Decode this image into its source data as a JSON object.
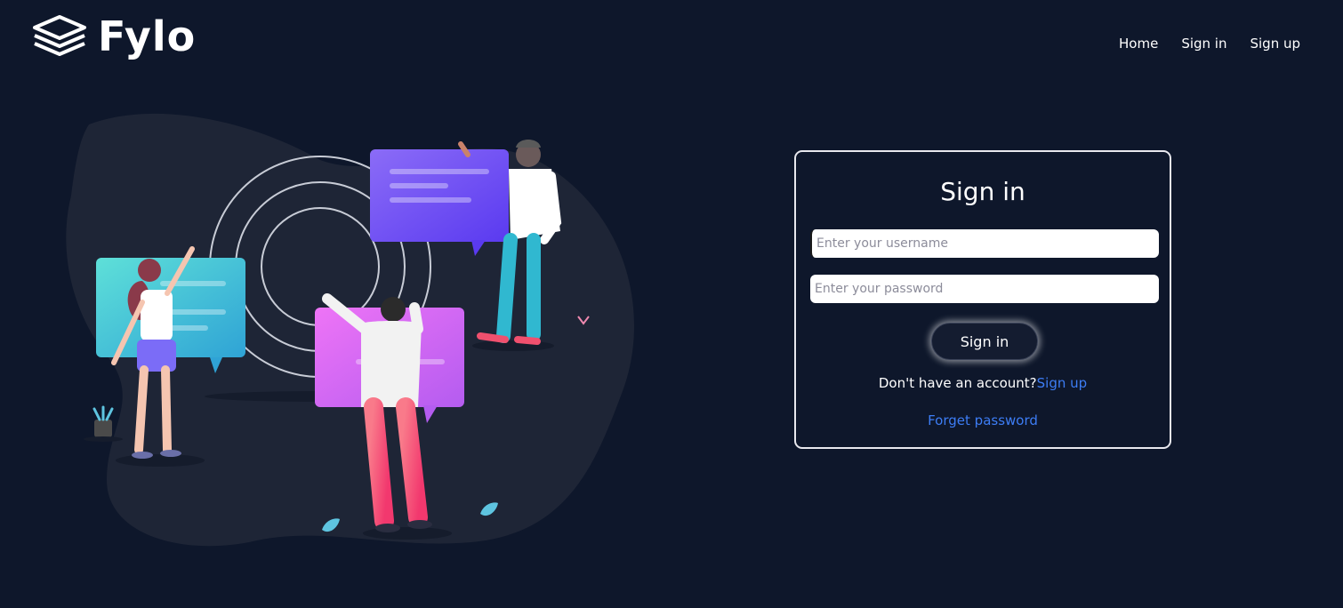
{
  "brand": {
    "name": "Fylo",
    "icon": "stacked-layers-icon"
  },
  "nav": {
    "items": [
      "Home",
      "Sign in",
      "Sign up"
    ]
  },
  "signin_form": {
    "title": "Sign in",
    "username_placeholder": "Enter your username",
    "password_placeholder": "Enter your password",
    "submit_label": "Sign in",
    "no_account_text": "Don't have an account?",
    "signup_link": "Sign up",
    "forgot_link": "Forget password"
  },
  "colors": {
    "background": "#0e172b",
    "link": "#3d7df5",
    "card_border": "#e8e8ee"
  }
}
